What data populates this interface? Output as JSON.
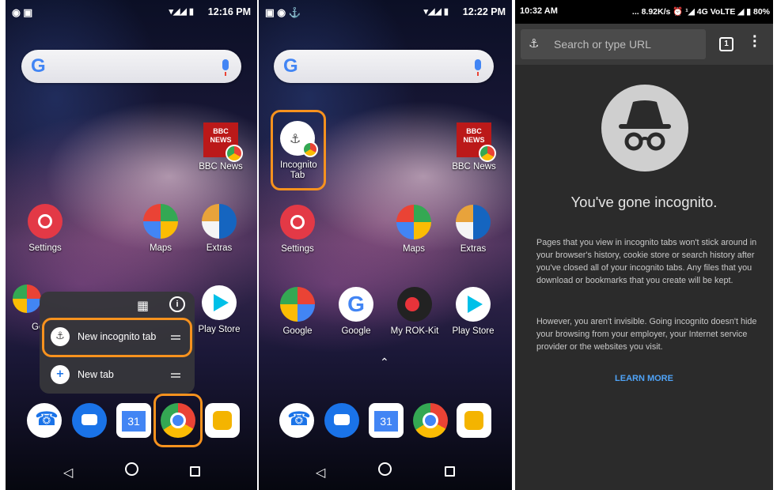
{
  "panel1": {
    "status_time": "12:16 PM",
    "apps_row1": [
      {
        "label": "BBC News",
        "icon": "bbc-news-icon"
      }
    ],
    "apps_row2": [
      {
        "label": "Settings",
        "icon": "settings-gear-icon"
      },
      {
        "label": "Maps",
        "icon": "maps-icon"
      },
      {
        "label": "Extras",
        "icon": "extras-folder-icon"
      }
    ],
    "apps_row3": [
      {
        "label": "Go",
        "icon": "google-folder-icon"
      },
      {
        "label": "Play Store",
        "icon": "play-store-icon"
      }
    ],
    "dock_calendar_num": "31",
    "popup": {
      "new_incognito_tab": "New incognito tab",
      "new_tab": "New tab"
    }
  },
  "panel2": {
    "status_time": "12:22 PM",
    "incognito_shortcut_label": "Incognito Tab",
    "bbc_label": "BBC News",
    "apps_row2": [
      {
        "label": "Settings",
        "icon": "settings-gear-icon"
      },
      {
        "label": "Maps",
        "icon": "maps-icon"
      },
      {
        "label": "Extras",
        "icon": "extras-folder-icon"
      }
    ],
    "apps_row3": [
      {
        "label": "Google",
        "icon": "google-folder-icon"
      },
      {
        "label": "Google",
        "icon": "google-app-icon"
      },
      {
        "label": "My ROK-Kit",
        "icon": "rok-kit-icon"
      },
      {
        "label": "Play Store",
        "icon": "play-store-icon"
      }
    ],
    "dock_calendar_num": "31"
  },
  "panel3": {
    "status_time": "10:32 AM",
    "status_right": "... 8.92K/s ⏰ ¹◢ 4G VoLTE ◢ ▮ 80%",
    "search_placeholder": "Search or type URL",
    "tab_count": "1",
    "heading": "You've gone incognito.",
    "para1": "Pages that you view in incognito tabs won't stick around in your browser's history, cookie store or search history after you've closed all of your incognito tabs. Any files that you download or bookmarks that you create will be kept.",
    "para2": "However, you aren't invisible. Going incognito doesn't hide your browsing from your employer, your Internet service provider or the websites you visit.",
    "learn_more": "LEARN MORE"
  },
  "colors": {
    "highlight": "#f7921e",
    "link": "#4fa3f7",
    "incognito_bg": "#2b2b2b"
  }
}
